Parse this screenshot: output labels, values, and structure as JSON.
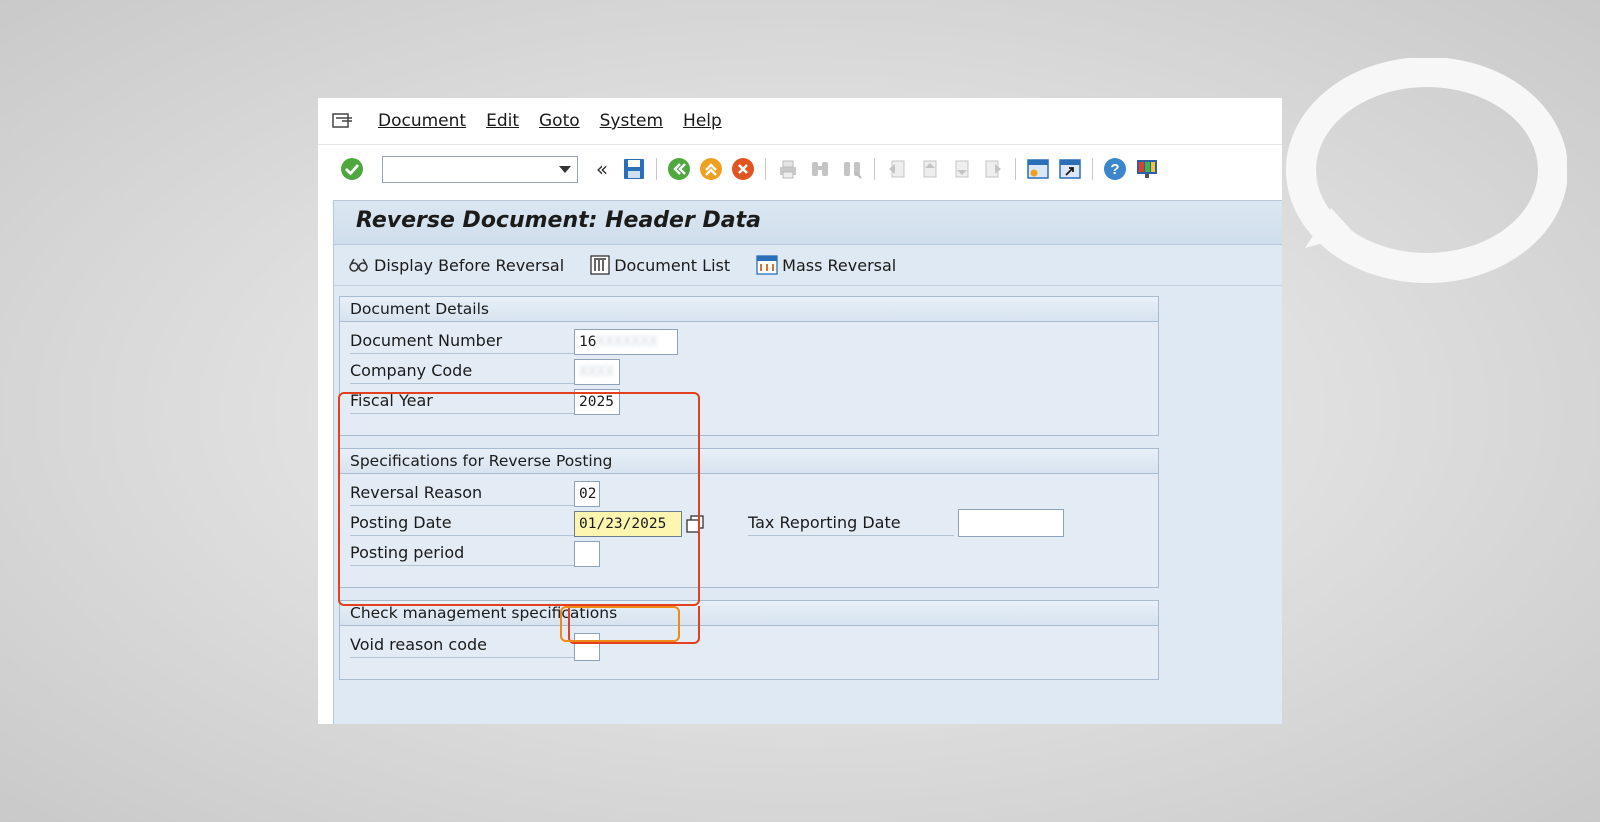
{
  "menu": {
    "items": [
      {
        "label": "Document",
        "key": "D"
      },
      {
        "label": "Edit",
        "key": "E"
      },
      {
        "label": "Goto",
        "key": "G"
      },
      {
        "label": "System",
        "key": "S"
      },
      {
        "label": "Help",
        "key": "H"
      }
    ]
  },
  "toolbar": {
    "command_value": "",
    "icons": [
      "enter-check-icon",
      "save-icon",
      "back-icon",
      "exit-icon",
      "cancel-icon",
      "print-icon",
      "find-icon",
      "find-next-icon",
      "first-page-icon",
      "previous-page-icon",
      "next-page-icon",
      "last-page-icon",
      "create-session-icon",
      "shortcut-icon",
      "help-icon",
      "customize-layout-icon"
    ]
  },
  "screen": {
    "title": "Reverse Document: Header Data"
  },
  "app_toolbar": {
    "display_before_reversal": "Display Before Reversal",
    "document_list": "Document List",
    "mass_reversal": "Mass Reversal"
  },
  "document_details": {
    "header": "Document Details",
    "document_number_label": "Document Number",
    "document_number_value": "16",
    "company_code_label": "Company Code",
    "company_code_value": "",
    "fiscal_year_label": "Fiscal Year",
    "fiscal_year_value": "2025"
  },
  "reverse_posting": {
    "header": "Specifications for Reverse Posting",
    "reversal_reason_label": "Reversal Reason",
    "reversal_reason_value": "02",
    "posting_date_label": "Posting Date",
    "posting_date_value": "01/23/2025",
    "tax_reporting_date_label": "Tax Reporting Date",
    "tax_reporting_date_value": "",
    "posting_period_label": "Posting period",
    "posting_period_value": ""
  },
  "check_management": {
    "header": "Check management specifications",
    "void_reason_code_label": "Void reason code",
    "void_reason_code_value": ""
  },
  "colors": {
    "highlight_red": "#e2401e",
    "highlight_orange": "#f08a16",
    "group_background": "#e3ecf5",
    "posting_date_background": "#fdf6b0"
  }
}
